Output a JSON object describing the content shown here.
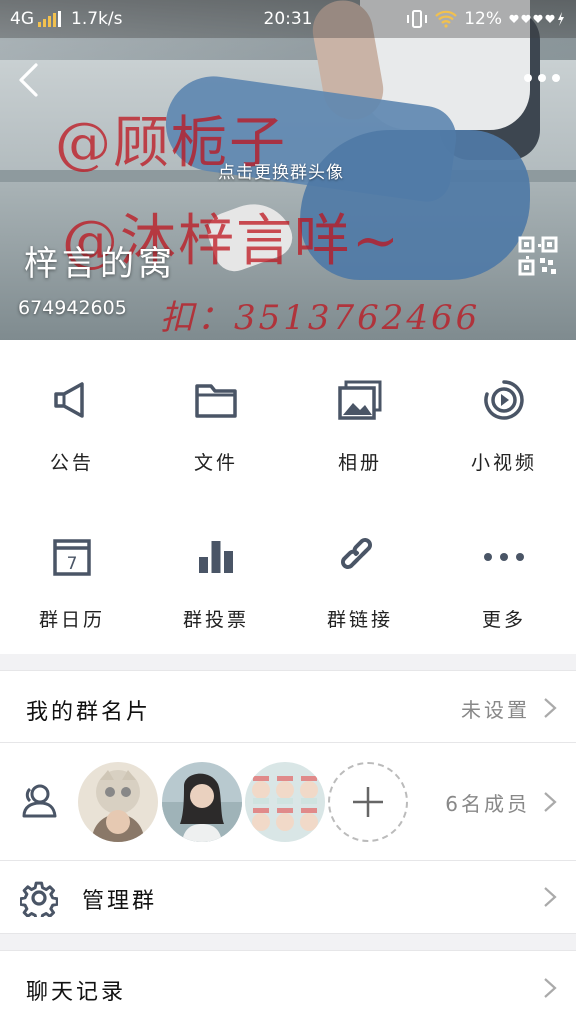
{
  "status_bar": {
    "network": "4G",
    "speed": "1.7k/s",
    "time": "20:31",
    "battery": "12%"
  },
  "cover": {
    "overlay_text_1": "@顾栀子",
    "overlay_text_2": "@沐梓言咩~",
    "overlay_text_3": "扣：3513762466",
    "change_avatar_hint": "点击更换群头像",
    "group_name": "梓言的窝",
    "group_id": "674942605"
  },
  "grid": {
    "items": [
      {
        "label": "公告",
        "icon": "megaphone-icon"
      },
      {
        "label": "文件",
        "icon": "folder-icon"
      },
      {
        "label": "相册",
        "icon": "photo-album-icon"
      },
      {
        "label": "小视频",
        "icon": "video-icon"
      },
      {
        "label": "群日历",
        "icon": "calendar-icon",
        "calendar_day": "7"
      },
      {
        "label": "群投票",
        "icon": "bar-chart-icon"
      },
      {
        "label": "群链接",
        "icon": "link-icon"
      },
      {
        "label": "更多",
        "icon": "more-dots-icon"
      }
    ]
  },
  "list": {
    "my_card": {
      "title": "我的群名片",
      "value": "未设置"
    },
    "members": {
      "value": "6名成员"
    },
    "manage": {
      "title": "管理群"
    },
    "chat_history": {
      "title": "聊天记录"
    }
  },
  "colors": {
    "icon": "#4a5566",
    "overlay_red": "#be141e",
    "divider": "#e6e6e8",
    "background": "#f2f2f4"
  }
}
